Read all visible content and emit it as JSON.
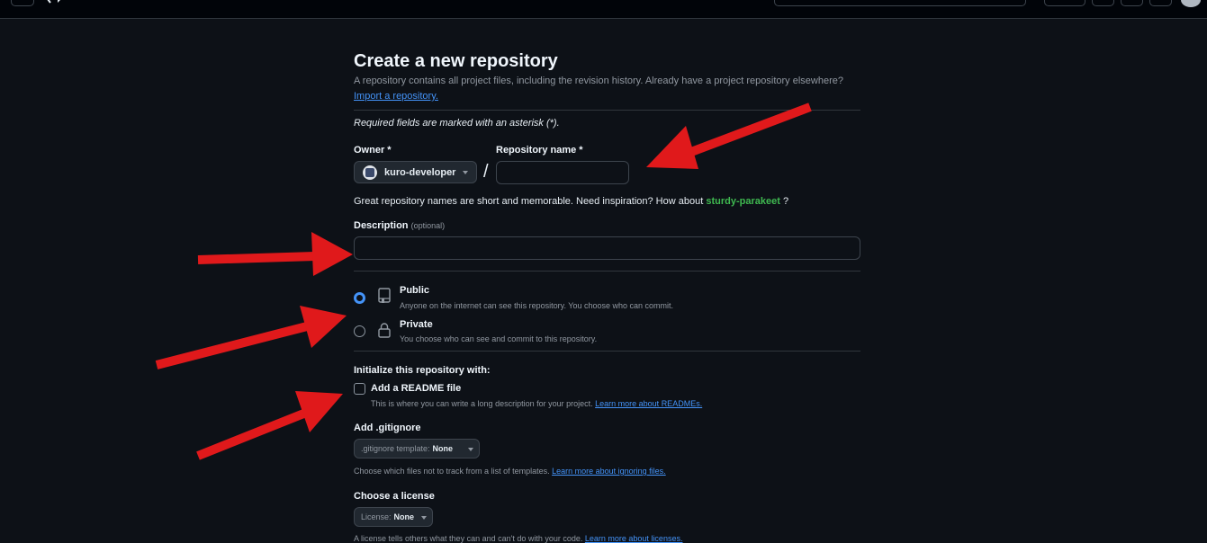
{
  "page": {
    "title": "Create a new repository",
    "intro": "A repository contains all project files, including the revision history. Already have a project repository elsewhere?",
    "import_link": "Import a repository.",
    "required_note": "Required fields are marked with an asterisk (*)."
  },
  "owner": {
    "label": "Owner *",
    "value": "kuro-developer"
  },
  "repo_name": {
    "label": "Repository name *",
    "value": ""
  },
  "name_hint": {
    "text": "Great repository names are short and memorable. Need inspiration? How about",
    "suggestion": "sturdy-parakeet",
    "end": "?"
  },
  "description": {
    "label": "Description",
    "optional": "(optional)",
    "value": ""
  },
  "visibility": {
    "selected": "Public",
    "options": [
      {
        "title": "Public",
        "desc": "Anyone on the internet can see this repository. You choose who can commit.",
        "icon": "repo-icon"
      },
      {
        "title": "Private",
        "desc": "You choose who can see and commit to this repository.",
        "icon": "lock-icon"
      }
    ]
  },
  "init": {
    "heading": "Initialize this repository with:",
    "readme_label": "Add a README file",
    "readme_checked": false,
    "readme_desc": "This is where you can write a long description for your project.",
    "readme_link": "Learn more about READMEs."
  },
  "gitignore": {
    "heading": "Add .gitignore",
    "dropdown_label": ".gitignore template:",
    "dropdown_value": "None",
    "note": "Choose which files not to track from a list of templates.",
    "note_link": "Learn more about ignoring files."
  },
  "license": {
    "heading": "Choose a license",
    "dropdown_label": "License:",
    "dropdown_value": "None",
    "note": "A license tells others what they can and can't do with your code.",
    "note_link": "Learn more about licenses."
  },
  "colors": {
    "background": "#0d1117",
    "link": "#4493f8",
    "suggestion": "#3fb950",
    "annotation_arrow": "#e0191b"
  }
}
